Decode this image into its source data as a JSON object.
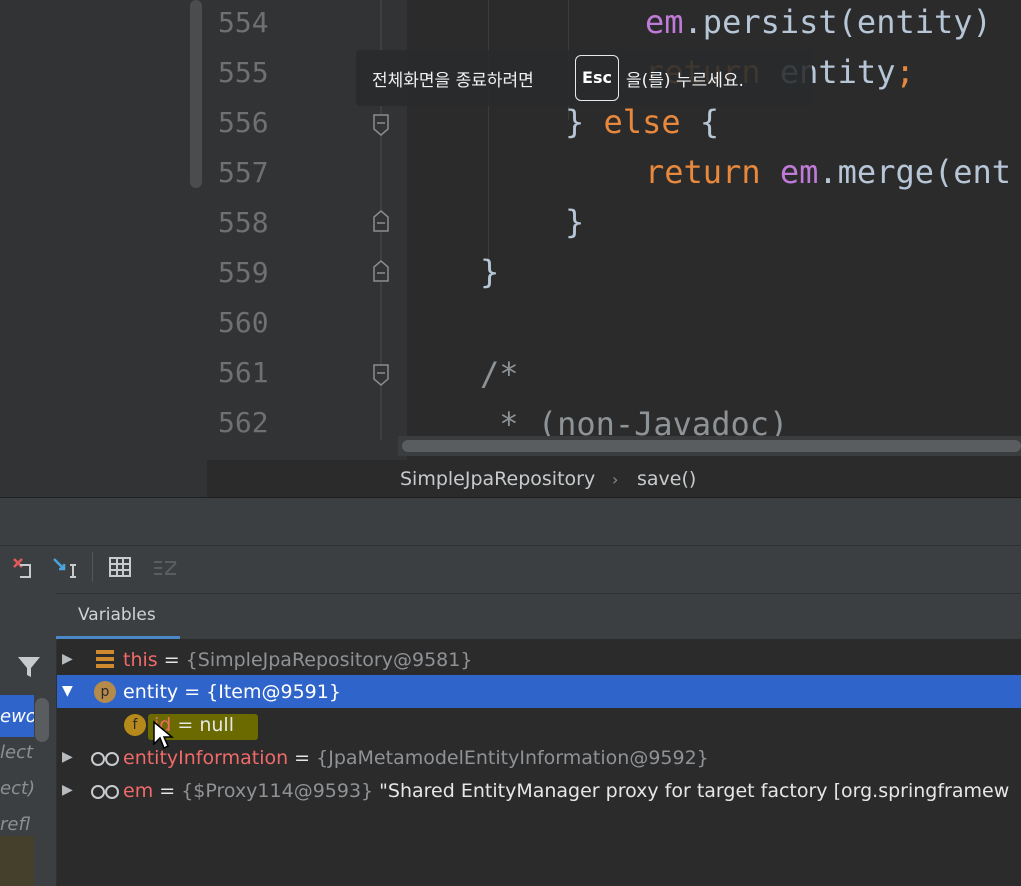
{
  "editor": {
    "lines": [
      {
        "num": "554"
      },
      {
        "num": "555"
      },
      {
        "num": "556"
      },
      {
        "num": "557"
      },
      {
        "num": "558"
      },
      {
        "num": "559"
      },
      {
        "num": "560"
      },
      {
        "num": "561"
      },
      {
        "num": "562"
      }
    ],
    "code": {
      "l554_a": "em",
      "l554_b": ".persist(entity)",
      "l555_a": "return",
      "l555_b": " entity",
      "l555_c": ";",
      "l556_a": "} ",
      "l556_b": "else",
      "l556_c": " {",
      "l557_a": "return",
      "l557_b": " em",
      "l557_c": ".merge(ent",
      "l558": "}",
      "l559": "}",
      "l561": "/*",
      "l562": " * (non-Javadoc)"
    },
    "breadcrumb": [
      "SimpleJpaRepository",
      "save()"
    ],
    "breadcrumb_sep": "›"
  },
  "toast": {
    "pre": "전체화면을 종료하려면",
    "key": "Esc",
    "post": "을(를) 누르세요."
  },
  "debugger": {
    "tab": "Variables",
    "frames": [
      "ewo",
      "lect",
      "ect)",
      "refl"
    ],
    "variables": [
      {
        "name": "this",
        "eq": " = ",
        "value": "{SimpleJpaRepository@9581}",
        "icon": "field-list-icon"
      },
      {
        "name": "entity",
        "eq": " = ",
        "value": "{Item@9591}",
        "icon": "p"
      },
      {
        "name": "id",
        "eq": " = ",
        "value": "null",
        "icon": "f"
      },
      {
        "name": "entityInformation",
        "eq": " = ",
        "value": "{JpaMetamodelEntityInformation@9592}",
        "icon": "watch-icon"
      },
      {
        "name": "em",
        "eq": " = ",
        "value": "{$Proxy114@9593}",
        "extra": " \"Shared EntityManager proxy for target factory [org.springframew",
        "icon": "watch-icon"
      }
    ]
  },
  "colors": {
    "selection": "#2f65ca",
    "keyword": "#e7883c",
    "var_name": "#f06a6a"
  }
}
